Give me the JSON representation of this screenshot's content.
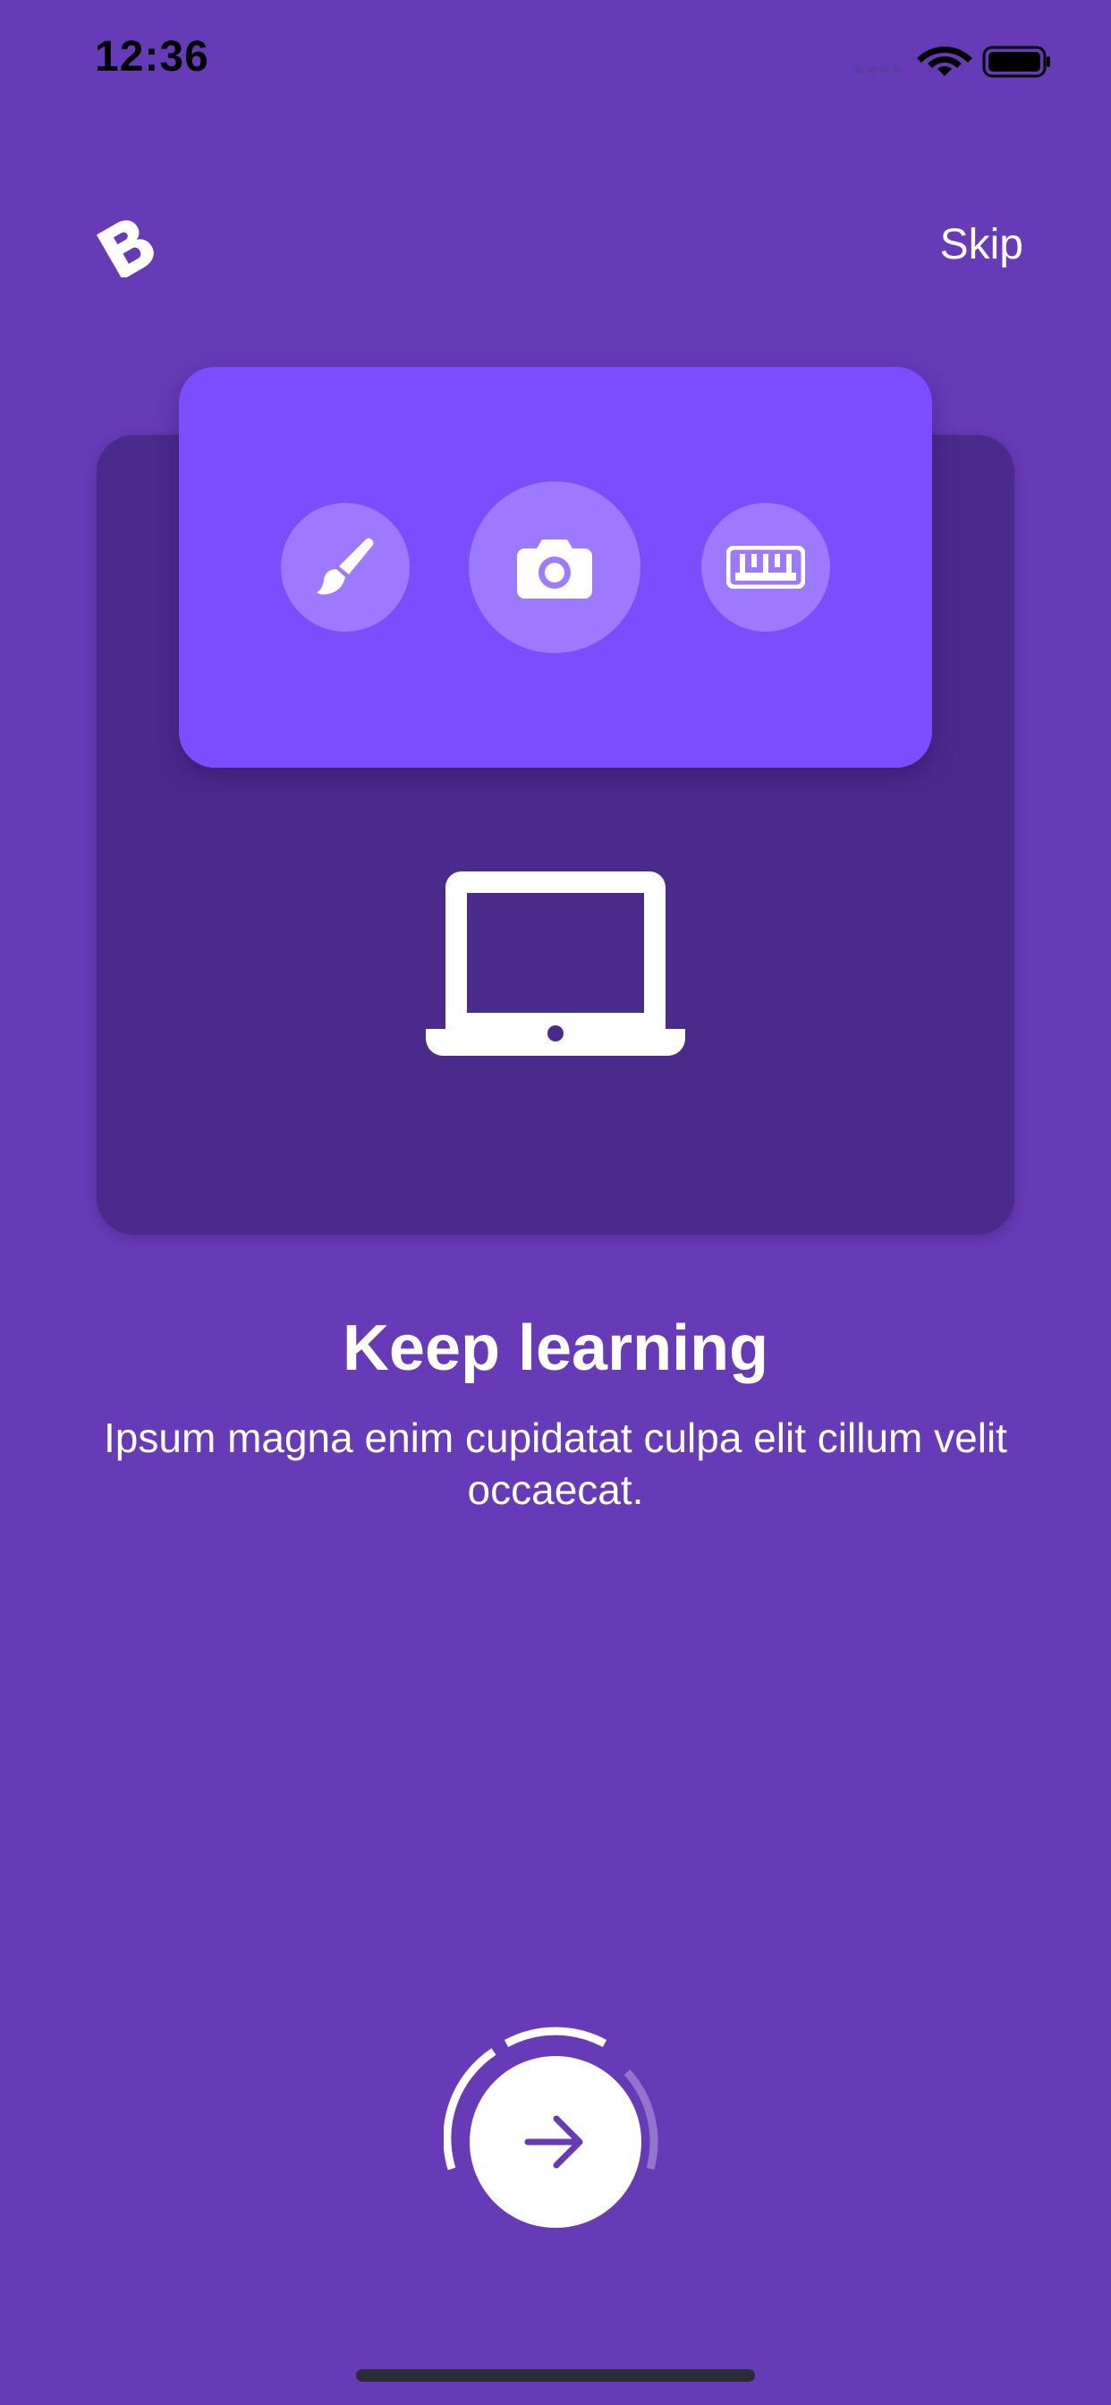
{
  "status_bar": {
    "time": "12:36",
    "icons": [
      "signal-icon",
      "wifi-icon",
      "battery-icon"
    ]
  },
  "header": {
    "logo_icon": "b-logo-icon",
    "skip_label": "Skip"
  },
  "illustration": {
    "tool_icons": [
      "brush-icon",
      "camera-icon",
      "ruler-icon"
    ],
    "device_icon": "laptop-icon"
  },
  "content": {
    "title": "Keep learning",
    "subtitle": "Ipsum magna enim cupidatat culpa elit cillum velit occaecat."
  },
  "navigation": {
    "next_icon": "arrow-right-icon",
    "progress": 0.5
  },
  "colors": {
    "background": "#673AB7",
    "back_card": "#4A2B8C",
    "front_card": "#7C4DFF",
    "accent": "#ffffff"
  }
}
